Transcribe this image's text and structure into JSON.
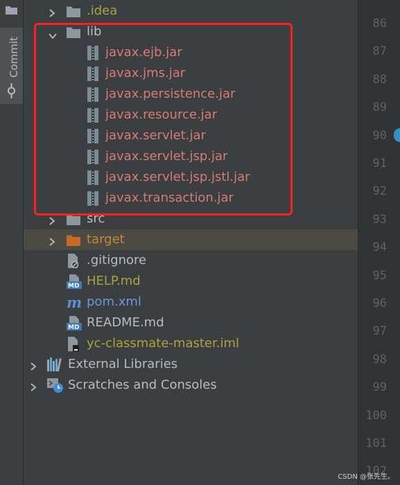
{
  "sidebar": {
    "commit_label": "Commit"
  },
  "tree": [
    {
      "id": "idea",
      "label": ".idea",
      "arrow": "right",
      "icon": "folder",
      "color": "olive"
    },
    {
      "id": "lib",
      "label": "lib",
      "arrow": "down",
      "icon": "folder",
      "color": "light"
    },
    {
      "id": "jar-ejb",
      "label": "javax.ejb.jar",
      "icon": "jar",
      "color": "red"
    },
    {
      "id": "jar-jms",
      "label": "javax.jms.jar",
      "icon": "jar",
      "color": "red"
    },
    {
      "id": "jar-persistence",
      "label": "javax.persistence.jar",
      "icon": "jar",
      "color": "red"
    },
    {
      "id": "jar-resource",
      "label": "javax.resource.jar",
      "icon": "jar",
      "color": "red"
    },
    {
      "id": "jar-servlet",
      "label": "javax.servlet.jar",
      "icon": "jar",
      "color": "red"
    },
    {
      "id": "jar-servlet-jsp",
      "label": "javax.servlet.jsp.jar",
      "icon": "jar",
      "color": "red"
    },
    {
      "id": "jar-servlet-jsp-jstl",
      "label": "javax.servlet.jsp.jstl.jar",
      "icon": "jar",
      "color": "red"
    },
    {
      "id": "jar-transaction",
      "label": "javax.transaction.jar",
      "icon": "jar",
      "color": "red"
    },
    {
      "id": "src",
      "label": "src",
      "arrow": "right",
      "icon": "folder",
      "color": "light"
    },
    {
      "id": "target",
      "label": "target",
      "arrow": "right",
      "icon": "folder-orange",
      "color": "orange",
      "selected": true
    },
    {
      "id": "gitignore",
      "label": ".gitignore",
      "icon": "gitignore-file",
      "color": "light"
    },
    {
      "id": "help-md",
      "label": "HELP.md",
      "icon": "markdown-file",
      "color": "olive"
    },
    {
      "id": "pom-xml",
      "label": "pom.xml",
      "icon": "maven-file",
      "color": "blue"
    },
    {
      "id": "readme-md",
      "label": "README.md",
      "icon": "markdown-file",
      "color": "light"
    },
    {
      "id": "iml",
      "label": "yc-classmate-master.iml",
      "icon": "module-file",
      "color": "olive"
    },
    {
      "id": "external-libraries",
      "label": "External Libraries",
      "arrow": "right",
      "icon": "libraries",
      "color": "light"
    },
    {
      "id": "scratches",
      "label": "Scratches and Consoles",
      "arrow": "right",
      "icon": "scratches",
      "color": "light"
    }
  ],
  "line_numbers": [
    "86",
    "87",
    "88",
    "89",
    "90",
    "91",
    "92",
    "93",
    "94",
    "95",
    "96",
    "97",
    "98",
    "99",
    "100",
    "101",
    "102"
  ],
  "watermark": "CSDN @张先生。",
  "colors": {
    "highlight_box": "#ff1f1f",
    "selected_row": "#4b4a43",
    "background": "#3c3f41"
  }
}
